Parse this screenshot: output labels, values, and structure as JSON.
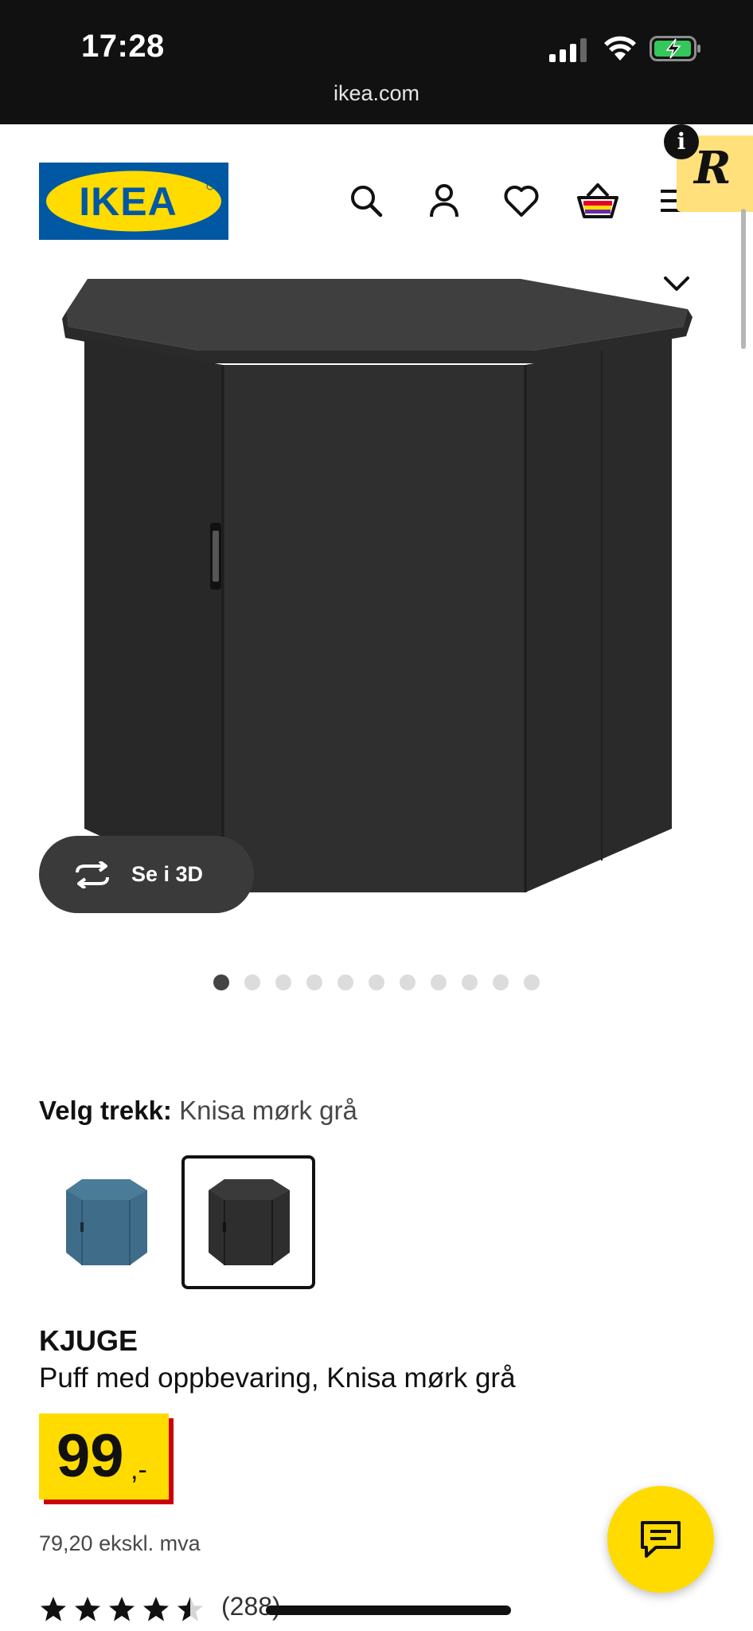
{
  "status_bar": {
    "time": "17:28",
    "url": "ikea.com",
    "icons": [
      "signal-icon",
      "wifi-icon",
      "battery-charging-icon"
    ]
  },
  "header": {
    "logo_text": "IKEA",
    "icons": [
      "search-icon",
      "user-icon",
      "heart-icon",
      "cart-icon",
      "menu-icon"
    ],
    "extension_badge_letter": "R"
  },
  "gallery": {
    "view_3d_label": "Se i 3D",
    "dot_count": 11,
    "active_index": 0
  },
  "variant": {
    "label": "Velg trekk:",
    "value": " Knisa mørk grå",
    "options": [
      {
        "color": "#3f6c88",
        "selected": false
      },
      {
        "color": "#2e2e2e",
        "selected": true
      }
    ]
  },
  "product": {
    "name": "KJUGE",
    "description": "Puff med oppbevaring, Knisa mørk grå",
    "price_integer": "99",
    "price_suffix": ",-",
    "price_ex_vat": "79,20 ekskl. mva",
    "rating": 4.5,
    "rating_count": "(288)"
  },
  "colors": {
    "brand_yellow": "#ffdb00",
    "brand_blue": "#0058a3",
    "price_red": "#cc0008"
  }
}
